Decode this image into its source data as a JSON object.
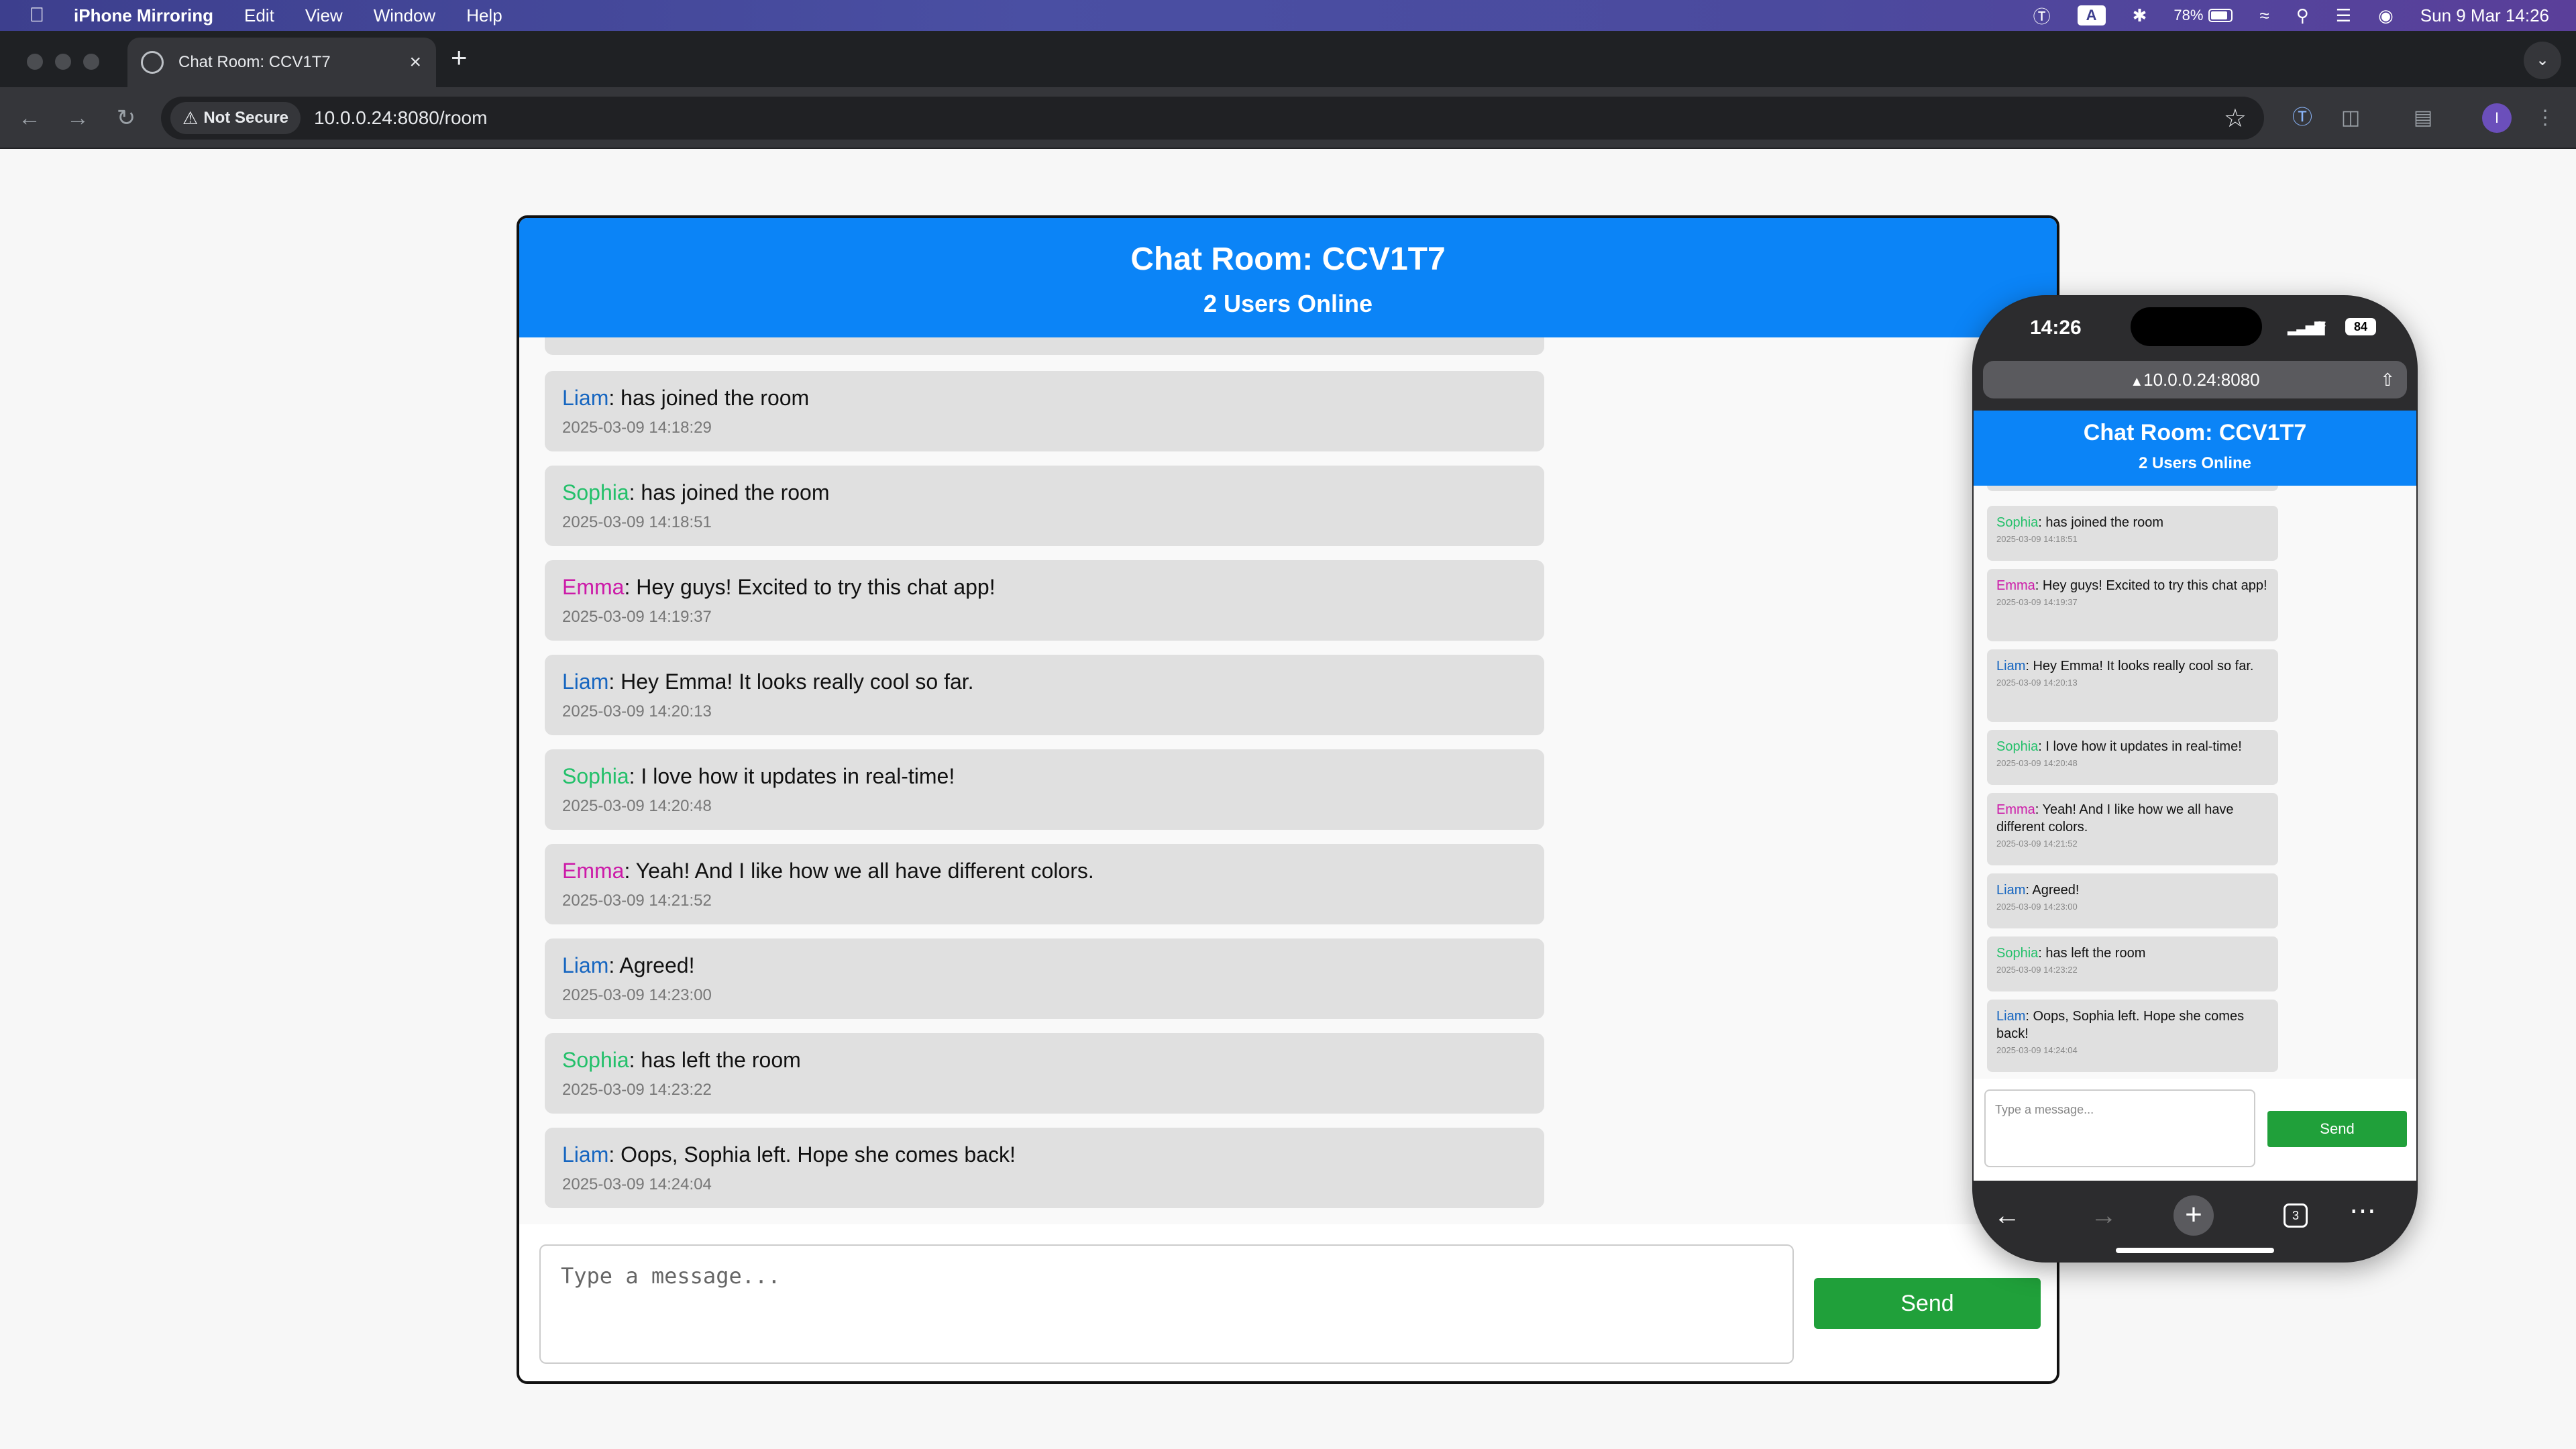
{
  "menubar": {
    "apple_icon": "apple-logo",
    "app_name": "iPhone Mirroring",
    "items": [
      "Edit",
      "View",
      "Window",
      "Help"
    ],
    "battery_percent": "78%",
    "keyboard_input": "A",
    "datetime": "Sun 9 Mar  14:26"
  },
  "browser": {
    "tab_title": "Chat Room: CCV1T7",
    "new_tab_label": "+",
    "security_label": "Not Secure",
    "url": "10.0.0.24:8080/room",
    "profile_initial": "I"
  },
  "chat": {
    "title": "Chat Room: CCV1T7",
    "users_online": "2 Users Online",
    "messages": [
      {
        "user": "Liam",
        "text": ": has joined the room",
        "timestamp": "2025-03-09 14:18:29",
        "color": "#1565c0"
      },
      {
        "user": "Sophia",
        "text": ": has joined the room",
        "timestamp": "2025-03-09 14:18:51",
        "color": "#23c06a"
      },
      {
        "user": "Emma",
        "text": ": Hey guys! Excited to try this chat app!",
        "timestamp": "2025-03-09 14:19:37",
        "color": "#cc1aa8"
      },
      {
        "user": "Liam",
        "text": ": Hey Emma! It looks really cool so far.",
        "timestamp": "2025-03-09 14:20:13",
        "color": "#1565c0"
      },
      {
        "user": "Sophia",
        "text": ": I love how it updates in real-time!",
        "timestamp": "2025-03-09 14:20:48",
        "color": "#23c06a"
      },
      {
        "user": "Emma",
        "text": ": Yeah! And I like how we all have different colors.",
        "timestamp": "2025-03-09 14:21:52",
        "color": "#cc1aa8"
      },
      {
        "user": "Liam",
        "text": ": Agreed!",
        "timestamp": "2025-03-09 14:23:00",
        "color": "#1565c0"
      },
      {
        "user": "Sophia",
        "text": ": has left the room",
        "timestamp": "2025-03-09 14:23:22",
        "color": "#23c06a"
      },
      {
        "user": "Liam",
        "text": ": Oops, Sophia left. Hope she comes back!",
        "timestamp": "2025-03-09 14:24:04",
        "color": "#1565c0"
      }
    ],
    "input_placeholder": "Type a message...",
    "send_label": "Send"
  },
  "phone": {
    "time": "14:26",
    "battery": "84",
    "url": "10.0.0.24:8080",
    "title": "Chat Room: CCV1T7",
    "users_online": "2 Users Online",
    "messages": [
      {
        "user": "Sophia",
        "text": ": has joined the room",
        "timestamp": "2025-03-09 14:18:51"
      },
      {
        "user": "Emma",
        "text": ": Hey guys! Excited to try this chat app!",
        "timestamp": "2025-03-09 14:19:37"
      },
      {
        "user": "Liam",
        "text": ": Hey Emma! It looks really cool so far.",
        "timestamp": "2025-03-09 14:20:13"
      },
      {
        "user": "Sophia",
        "text": ": I love how it updates in real-time!",
        "timestamp": "2025-03-09 14:20:48"
      },
      {
        "user": "Emma",
        "text": ": Yeah! And I like how we all have different colors.",
        "timestamp": "2025-03-09 14:21:52"
      },
      {
        "user": "Liam",
        "text": ": Agreed!",
        "timestamp": "2025-03-09 14:23:00"
      },
      {
        "user": "Sophia",
        "text": ": has left the room",
        "timestamp": "2025-03-09 14:23:22"
      },
      {
        "user": "Liam",
        "text": ": Oops, Sophia left. Hope she comes back!",
        "timestamp": "2025-03-09 14:24:04"
      }
    ],
    "input_placeholder": "Type a message...",
    "send_label": "Send",
    "tab_count": "3"
  },
  "colors": {
    "header_blue": "#0b84f7",
    "send_green": "#20a03a",
    "liam": "#1565c0",
    "sophia": "#23c06a",
    "emma": "#cc1aa8"
  }
}
